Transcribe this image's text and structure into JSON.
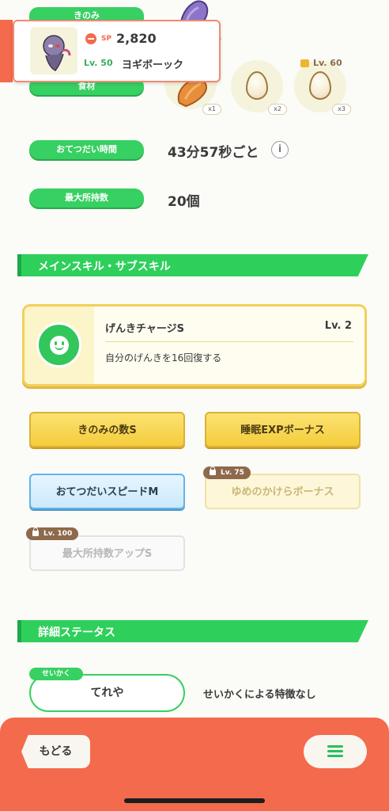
{
  "pills": {
    "berry": "きのみ",
    "ingredients": "食材",
    "help_time": "おてつだい時間",
    "max_carry": "最大所持数"
  },
  "pokemon": {
    "sp_label": "SP",
    "sp_value": "2,820",
    "level": "Lv. 50",
    "name": "ヨギボーック"
  },
  "ingredients": {
    "lock_level": "Lv. 60",
    "items": [
      {
        "name": "berry",
        "mult": "x1"
      },
      {
        "name": "egg",
        "mult": "x2"
      },
      {
        "name": "egg",
        "mult": "x3"
      }
    ]
  },
  "stats": {
    "help_time_value": "43分57秒ごと",
    "max_carry_value": "20個"
  },
  "sections": {
    "skills": "メインスキル・サブスキル",
    "details": "詳細ステータス"
  },
  "main_skill": {
    "name": "げんきチャージS",
    "level": "Lv. 2",
    "description": "自分のげんきを16回復する"
  },
  "sub_skills": [
    {
      "label": "きのみの数S",
      "locked": false
    },
    {
      "label": "睡眠EXPボーナス",
      "locked": false
    },
    {
      "label": "おてつだいスピードM",
      "locked": false
    },
    {
      "label": "ゆめのかけらボーナス",
      "locked": true,
      "lock_level": "Lv. 75"
    },
    {
      "label": "最大所持数アップS",
      "locked": true,
      "lock_level": "Lv. 100"
    }
  ],
  "nature": {
    "tag": "せいかく",
    "value": "てれや",
    "effect": "せいかくによる特徴なし"
  },
  "bottom": {
    "back_label": "もどる"
  },
  "colors": {
    "green": "#37d062",
    "coral": "#f46a4d",
    "gold": "#f5cd3c"
  }
}
